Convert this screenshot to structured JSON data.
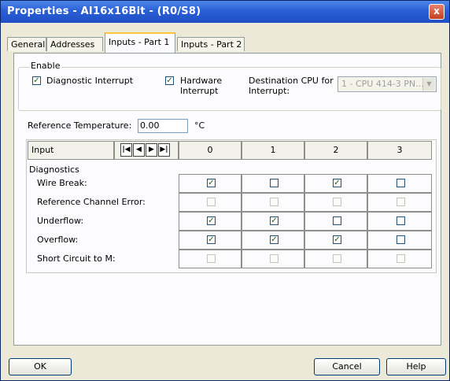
{
  "window": {
    "title": "Properties - AI16x16Bit - (R0/S8)",
    "close_label": "x"
  },
  "tabs": [
    {
      "label": "General",
      "active": false
    },
    {
      "label": "Addresses",
      "active": false
    },
    {
      "label": "Inputs - Part 1",
      "active": true
    },
    {
      "label": "Inputs - Part 2",
      "active": false
    }
  ],
  "enable": {
    "label": "Enable",
    "diagnostic_interrupt": {
      "label": "Diagnostic Interrupt",
      "checked": true
    },
    "hardware_interrupt": {
      "label_line1": "Hardware",
      "label_line2": "Interrupt",
      "checked": true
    },
    "destination_cpu": {
      "label_line1": "Destination CPU for",
      "label_line2": "Interrupt:",
      "value": "1 - CPU 414-3 PN..."
    }
  },
  "reference_temperature": {
    "label": "Reference Temperature:",
    "value": "0.00",
    "unit": "°C"
  },
  "table": {
    "input_header": "Input",
    "channels": [
      "0",
      "1",
      "2",
      "3"
    ],
    "section_label": "Diagnostics",
    "rows": [
      {
        "label": "Wire Break:",
        "checks": [
          true,
          false,
          true,
          false
        ],
        "enabled": true
      },
      {
        "label": "Reference Channel Error:",
        "checks": [
          false,
          false,
          false,
          false
        ],
        "enabled": false
      },
      {
        "label": "Underflow:",
        "checks": [
          true,
          true,
          false,
          false
        ],
        "enabled": true
      },
      {
        "label": "Overflow:",
        "checks": [
          true,
          true,
          true,
          false
        ],
        "enabled": true
      },
      {
        "label": "Short Circuit to M:",
        "checks": [
          false,
          false,
          false,
          false
        ],
        "enabled": false
      }
    ]
  },
  "buttons": {
    "ok": "OK",
    "cancel": "Cancel",
    "help": "Help"
  }
}
